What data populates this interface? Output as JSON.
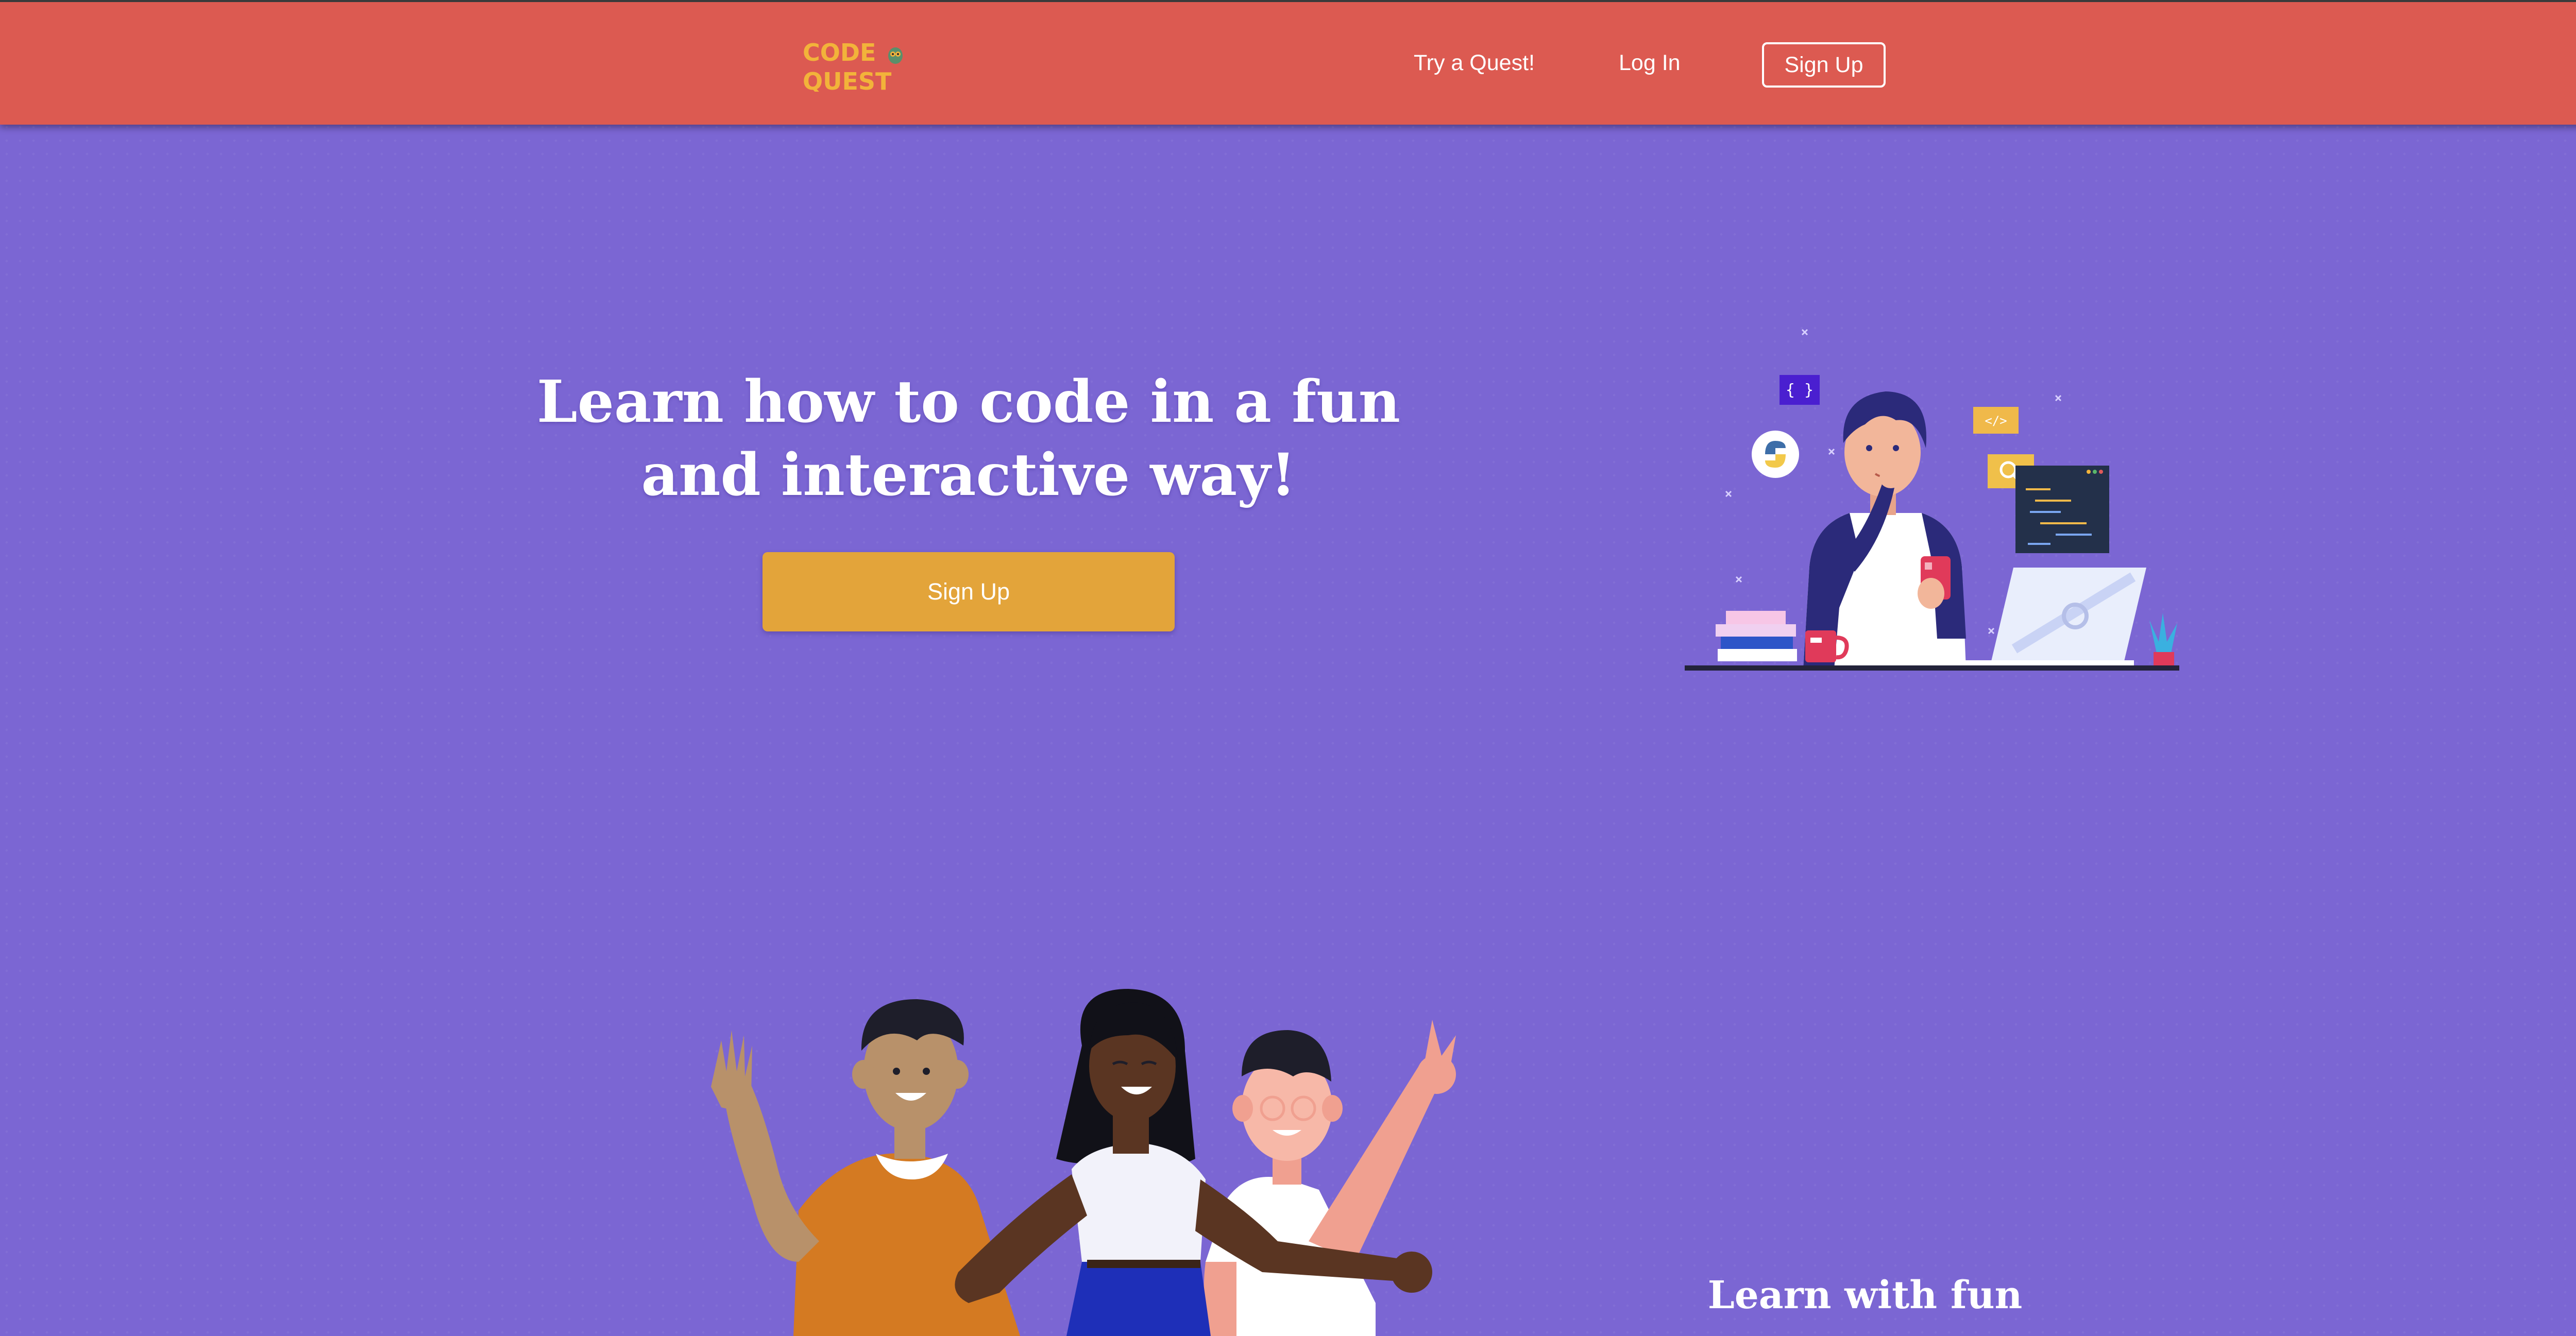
{
  "nav": {
    "logo_line1": "CODE",
    "logo_line2": "QUEST",
    "links": [
      {
        "label": "Try a Quest!"
      },
      {
        "label": "Log In"
      }
    ],
    "signup_label": "Sign Up"
  },
  "hero": {
    "title": "Learn how to code in a fun and interactive way!",
    "cta_label": "Sign Up"
  },
  "illustration": {
    "code_badge": "{ }",
    "tag_badge": "</>"
  },
  "section": {
    "title": "Learn with fun"
  },
  "colors": {
    "background": "#7b66d3",
    "navbar": "#dc5a51",
    "accent": "#e3a43a",
    "logo": "#f2b33a",
    "text": "#ffffff"
  },
  "icons": [
    "owl-icon",
    "python-icon",
    "search-icon",
    "code-brackets-icon",
    "laptop-icon",
    "phone-icon",
    "plant-icon"
  ]
}
